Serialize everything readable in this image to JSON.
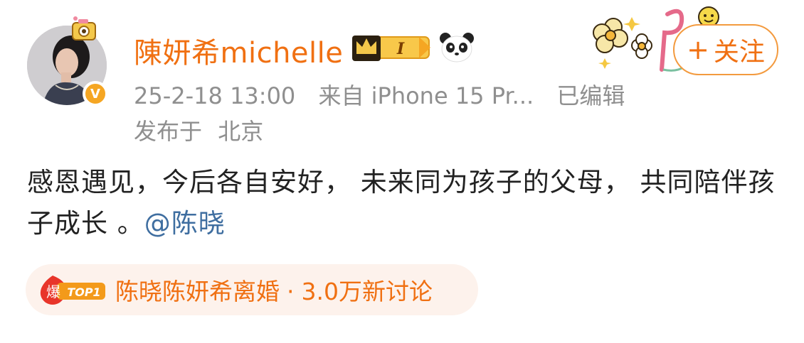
{
  "user": {
    "name": "陳妍希michelle",
    "badge_level": "I",
    "verified_mark": "V"
  },
  "post": {
    "date": "25-2-18 13:00",
    "source": "来自 iPhone 15 Pr...",
    "edited": "已编辑",
    "location_prefix": "发布于",
    "location": "北京",
    "content_text": "感恩遇见，今后各自安好， 未来同为孩子的父母， 共同陪伴孩子成长 。",
    "mention": "@陈晓"
  },
  "follow": {
    "plus": "+",
    "label": "关注"
  },
  "topic": {
    "hot_icon_char": "爆",
    "rank": "TOP1",
    "title": "陈晓陈妍希离婚",
    "separator": "·",
    "count": "3.0万新讨论"
  },
  "colors": {
    "accent": "#f07012",
    "meta_text": "#8f8f8f",
    "link": "#3f6ea0",
    "topic_bg": "#fdf2ec"
  }
}
